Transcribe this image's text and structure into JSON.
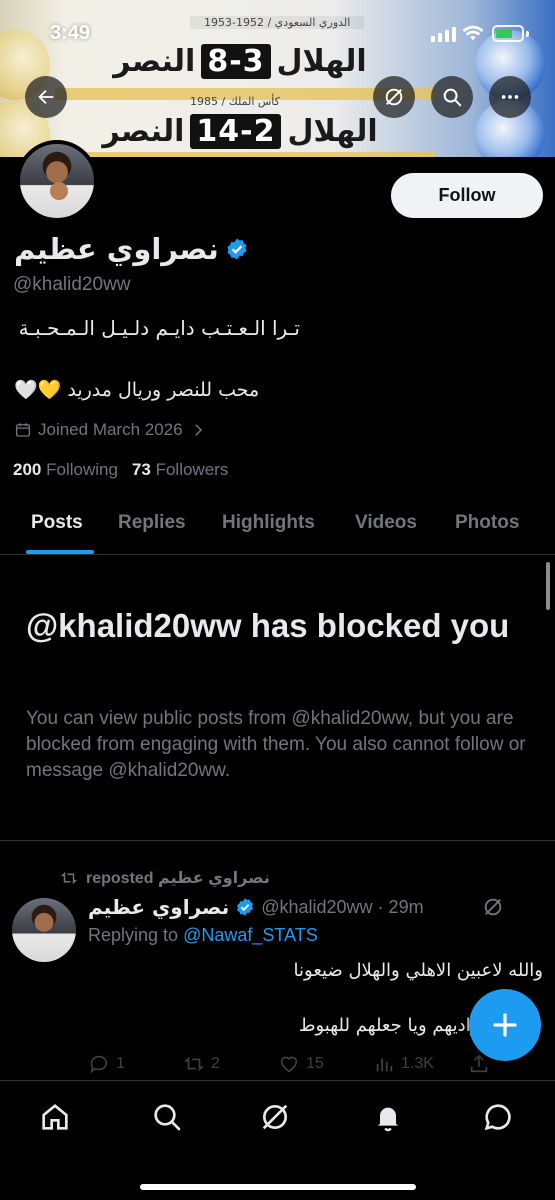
{
  "status_bar": {
    "time": "3:49"
  },
  "banner": {
    "row1_caption": "الدوري السعودي / 1952-1953",
    "row1_home": "الهلال",
    "row1_score": "8-3",
    "row1_away": "النصر",
    "row2_caption": "كأس الملك / 1985",
    "row2_home": "الهلال",
    "row2_score": "14-2",
    "row2_away": "النصر"
  },
  "profile": {
    "display_name": "نصراوي عظيم",
    "handle": "@khalid20ww",
    "bio_line1": "تـرا الـعـتـب دايـم دلـيـل الـمـحـبـة",
    "bio_line2": "محب للنصر وريال مدريد 💛🤍",
    "joined": "Joined March 2026",
    "following_count": "200",
    "following_label": "Following",
    "followers_count": "73",
    "followers_label": "Followers",
    "follow_button": "Follow"
  },
  "tabs": [
    "Posts",
    "Replies",
    "Highlights",
    "Videos",
    "Photos"
  ],
  "blocked": {
    "title": "@khalid20ww has blocked you",
    "description": "You can view public posts from @khalid20ww, but you are blocked from engaging with them. You also cannot follow or message @khalid20ww."
  },
  "tweet": {
    "repost_label": "نصراوي عظيم reposted",
    "author_name": "نصراوي عظيم",
    "author_meta": "@khalid20ww · 29m",
    "replying_prefix": "Replying to",
    "replying_to": "@Nawaf_STATS",
    "text_line1": "والله لاعبين الاهلي والهلال ضيعونا",
    "text_line2": "نواديهم ويا جعلهم للهبوط",
    "replies": "1",
    "reposts": "2",
    "likes": "15",
    "views": "1.3K"
  },
  "colors": {
    "accent": "#1d9bf0",
    "background": "#000000",
    "secondary_text": "#71767b"
  },
  "icons": {
    "back": "arrow-left-icon",
    "grok": "grok-icon",
    "search": "search-icon",
    "more": "more-icon",
    "calendar": "calendar-icon",
    "compose": "plus-icon",
    "nav": [
      "home-icon",
      "search-icon",
      "grok-icon",
      "bell-icon",
      "message-icon"
    ]
  }
}
